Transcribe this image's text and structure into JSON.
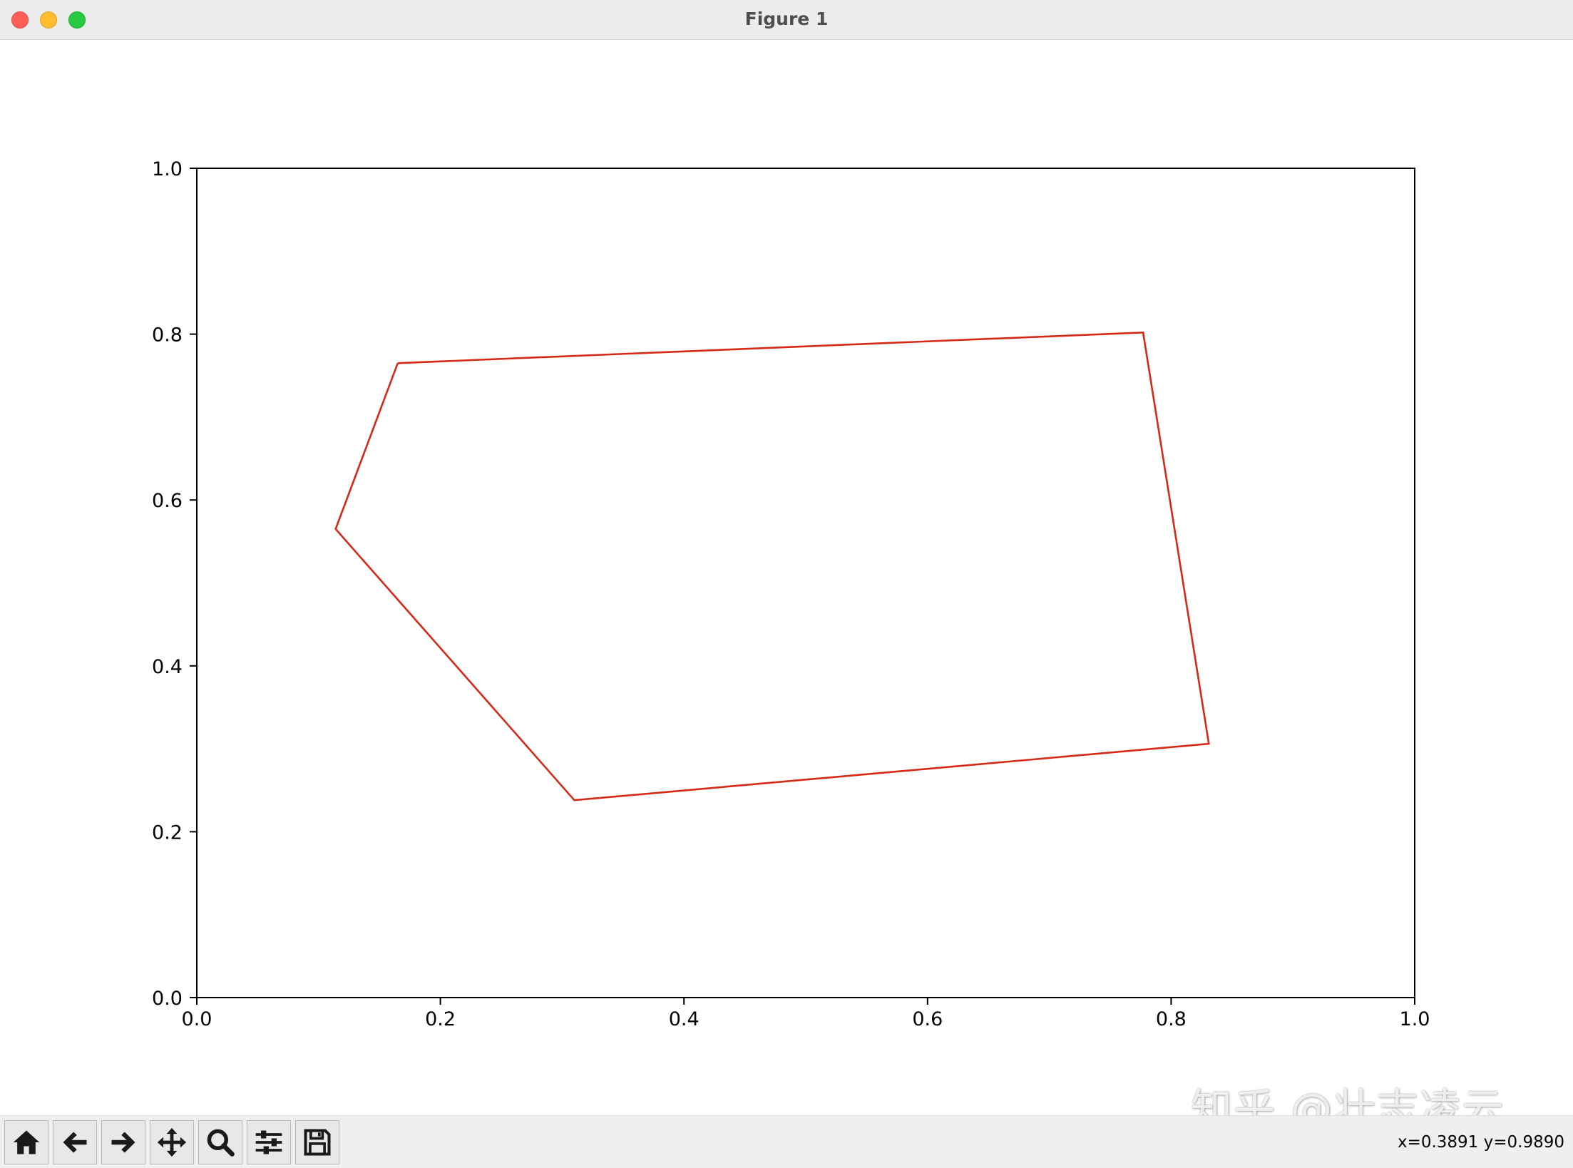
{
  "window": {
    "title": "Figure 1"
  },
  "chart_data": {
    "type": "line",
    "title": "",
    "xlabel": "",
    "ylabel": "",
    "xlim": [
      0.0,
      1.0
    ],
    "ylim": [
      0.0,
      1.0
    ],
    "xticks": [
      "0.0",
      "0.2",
      "0.4",
      "0.6",
      "0.8",
      "1.0"
    ],
    "yticks": [
      "0.0",
      "0.2",
      "0.4",
      "0.6",
      "0.8",
      "1.0"
    ],
    "grid": false,
    "series": [
      {
        "color": "#d62a16",
        "closed": true,
        "x": [
          0.165,
          0.777,
          0.831,
          0.31,
          0.114,
          0.165
        ],
        "y": [
          0.765,
          0.802,
          0.306,
          0.238,
          0.565,
          0.765
        ]
      }
    ]
  },
  "toolbar": {
    "buttons": [
      {
        "name": "home-button",
        "icon": "home-icon"
      },
      {
        "name": "back-button",
        "icon": "arrow-left-icon"
      },
      {
        "name": "forward-button",
        "icon": "arrow-right-icon"
      },
      {
        "name": "pan-button",
        "icon": "move-icon"
      },
      {
        "name": "zoom-button",
        "icon": "magnifier-icon"
      },
      {
        "name": "configure-subplots-button",
        "icon": "sliders-icon"
      },
      {
        "name": "save-button",
        "icon": "floppy-disk-icon"
      }
    ],
    "coordinates": "x=0.3891 y=0.9890"
  },
  "watermark": {
    "text": "知乎 @壮志凌云"
  }
}
